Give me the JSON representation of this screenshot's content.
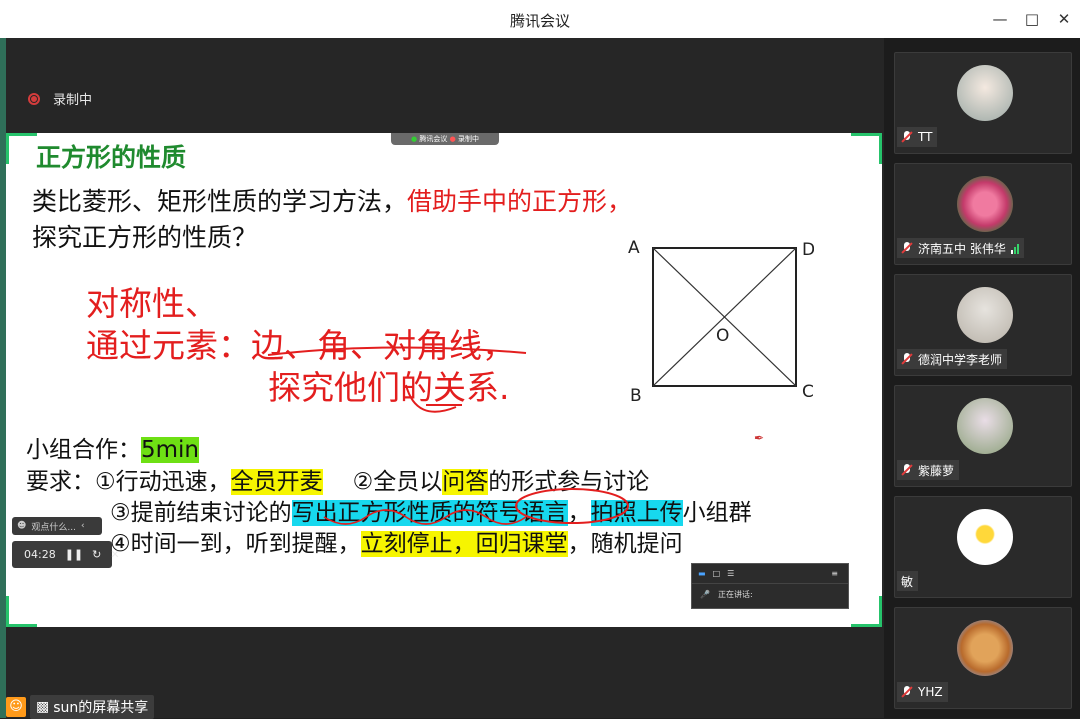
{
  "window": {
    "title": "腾讯会议"
  },
  "recording": {
    "label": "录制中"
  },
  "share_pill": {
    "app": "腾讯会议",
    "rec": "录制中"
  },
  "slide": {
    "title": "正方形的性质",
    "line1_black": "类比菱形、矩形性质的学习方法，",
    "line1_red": "借助手中的正方形，",
    "line2": "探究正方形的性质？",
    "red1": "对称性、",
    "red2": "通过元素：边、角、对角线，",
    "red3": "探究他们的关系.",
    "vertex_labels": {
      "A": "A",
      "D": "D",
      "B": "B",
      "C": "C",
      "O": "O"
    },
    "group": {
      "label": "小组合作：",
      "time": "5min"
    },
    "req_label": "要求：",
    "r1_a": "①行动迅速，",
    "r1_b": "全员开麦",
    "r1_c": "②全员以",
    "r1_d": "问答",
    "r1_e": "的形式参与讨论",
    "r2_a": "③提前结束讨论的",
    "r2_b": "写出正方形性质的",
    "r2_c": "符号语言",
    "r2_d": "，",
    "r2_e": "拍照上传",
    "r2_f": "小组群",
    "r3_a": "④时间一到，听到提醒，",
    "r3_b": "立刻停止，回归课堂",
    "r3_c": "，随机提问"
  },
  "mini_toolbar": {
    "label": "观点什么..."
  },
  "timer": {
    "time": "04:28"
  },
  "speaker_panel": {
    "label": "正在讲话:"
  },
  "screen_share": {
    "label": "sun的屏幕共享"
  },
  "participants": [
    {
      "name": "TT"
    },
    {
      "name": "济南五中  张伟华"
    },
    {
      "name": "德润中学李老师"
    },
    {
      "name": "紫藤萝"
    },
    {
      "name": "敏"
    },
    {
      "name": "YHZ"
    }
  ],
  "colors": {
    "accent_green": "#26c36b",
    "title_green": "#1f8a2e",
    "red": "#e31e1e",
    "highlight_yellow": "#f6f500",
    "highlight_cyan": "#17d8ee"
  }
}
